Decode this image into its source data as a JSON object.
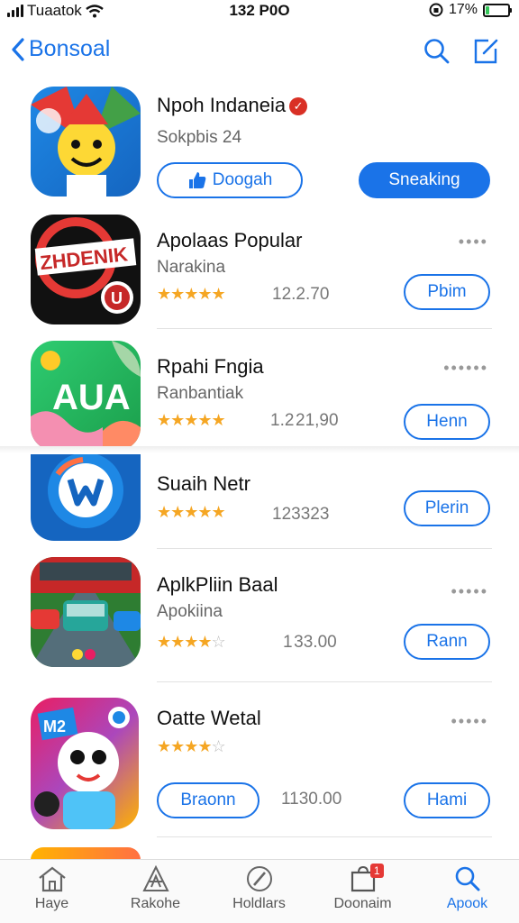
{
  "status": {
    "carrier": "Tuaatok",
    "time": "132 P0O",
    "battery": "17%",
    "battery_level": 0.17
  },
  "nav": {
    "back_label": "Bonsoal",
    "search_icon": "search-icon",
    "compose_icon": "compose-icon"
  },
  "featured": {
    "title": "Npoh Indaneia",
    "subtitle": "Sokpbis 24",
    "like_button": "Doogah",
    "primary_button": "Sneaking",
    "accent": "#1a73e8"
  },
  "apps": [
    {
      "title": "Apolaas Popular",
      "subtitle": "Narakina",
      "rating": 5,
      "count": "12.2.70",
      "button": "Pbim"
    },
    {
      "title": "Rpahi Fngia",
      "subtitle": "Ranbantiak",
      "rating": 5,
      "count": "1.2 21,90",
      "button": "Henn"
    },
    {
      "title": "Suaih Netr",
      "subtitle": "",
      "rating": 5,
      "count": "123323",
      "button": "Plerin"
    },
    {
      "title": "AplkPliin Baal",
      "subtitle": "Apokiina",
      "rating": 4,
      "count": "1 33.00",
      "button": "Rann"
    },
    {
      "title": "Oatte Wetal",
      "subtitle": "",
      "rating": 4,
      "count": "1130.00",
      "button": "Hami",
      "extra_button": "Braonn"
    }
  ],
  "tabs": [
    {
      "label": "Haye",
      "icon": "home-icon"
    },
    {
      "label": "Rakohe",
      "icon": "games-icon"
    },
    {
      "label": "Holdlars",
      "icon": "apps-icon"
    },
    {
      "label": "Doonaim",
      "icon": "updates-icon",
      "badge": "1"
    },
    {
      "label": "Apook",
      "icon": "search-icon",
      "active": true
    }
  ]
}
